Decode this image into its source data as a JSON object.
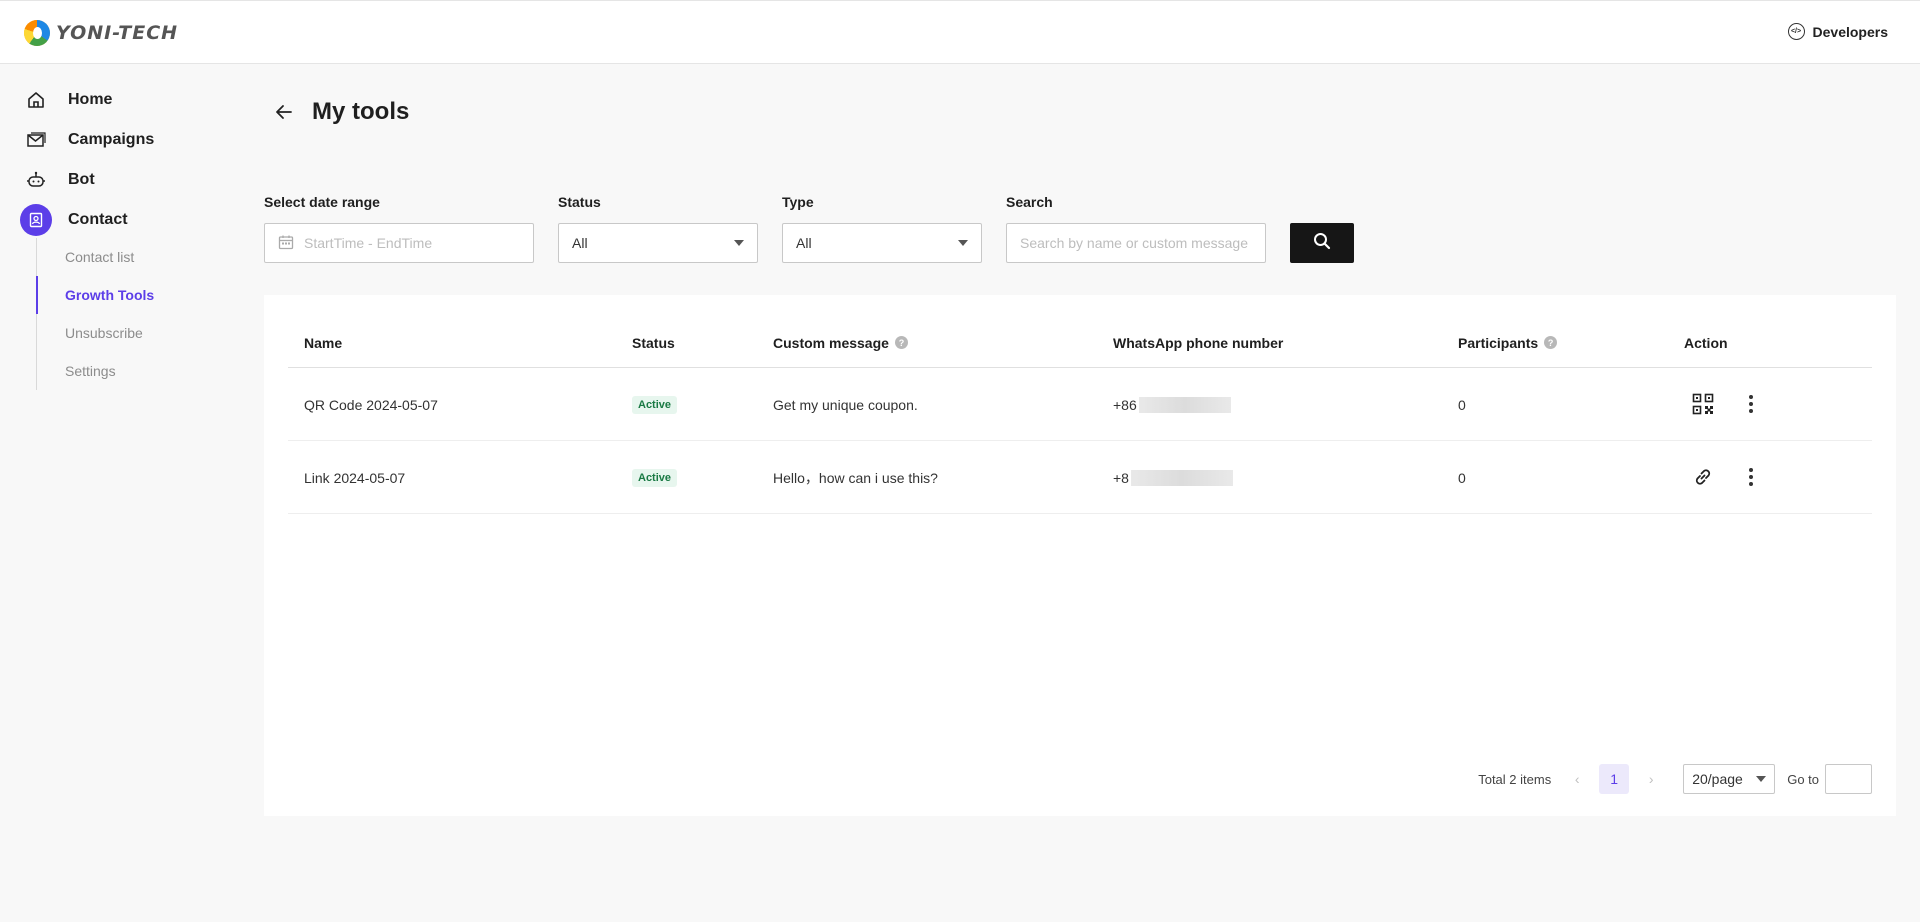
{
  "brand": {
    "name": "YONI-TECH"
  },
  "header": {
    "developers_label": "Developers"
  },
  "sidebar": {
    "items": [
      {
        "label": "Home",
        "icon": "home-icon"
      },
      {
        "label": "Campaigns",
        "icon": "campaigns-icon"
      },
      {
        "label": "Bot",
        "icon": "bot-icon"
      },
      {
        "label": "Contact",
        "icon": "contact-icon",
        "active": true
      }
    ],
    "sub_items": [
      {
        "label": "Contact list"
      },
      {
        "label": "Growth Tools",
        "active": true
      },
      {
        "label": "Unsubscribe"
      },
      {
        "label": "Settings"
      }
    ]
  },
  "page": {
    "title": "My tools"
  },
  "filters": {
    "date_label": "Select date range",
    "date_placeholder": "StartTime - EndTime",
    "status_label": "Status",
    "status_value": "All",
    "type_label": "Type",
    "type_value": "All",
    "search_label": "Search",
    "search_placeholder": "Search by name or custom message"
  },
  "table": {
    "headers": {
      "name": "Name",
      "status": "Status",
      "message": "Custom message",
      "phone": "WhatsApp phone number",
      "participants": "Participants",
      "action": "Action"
    },
    "rows": [
      {
        "name": "QR Code 2024-05-07",
        "status": "Active",
        "message": "Get my unique coupon.",
        "phone_prefix": "+86",
        "participants": "0",
        "action_icon": "qr-code-icon"
      },
      {
        "name": "Link 2024-05-07",
        "status": "Active",
        "message": "Hello，how can i use this?",
        "phone_prefix": "+8",
        "participants": "0",
        "action_icon": "link-icon"
      }
    ]
  },
  "pagination": {
    "total": "Total 2 items",
    "current_page": "1",
    "page_size": "20/page",
    "goto_label": "Go to"
  },
  "colors": {
    "accent": "#5c3ee8",
    "active_badge_bg": "#e7f6ee",
    "active_badge_text": "#1a7a44",
    "search_button": "#161616"
  }
}
